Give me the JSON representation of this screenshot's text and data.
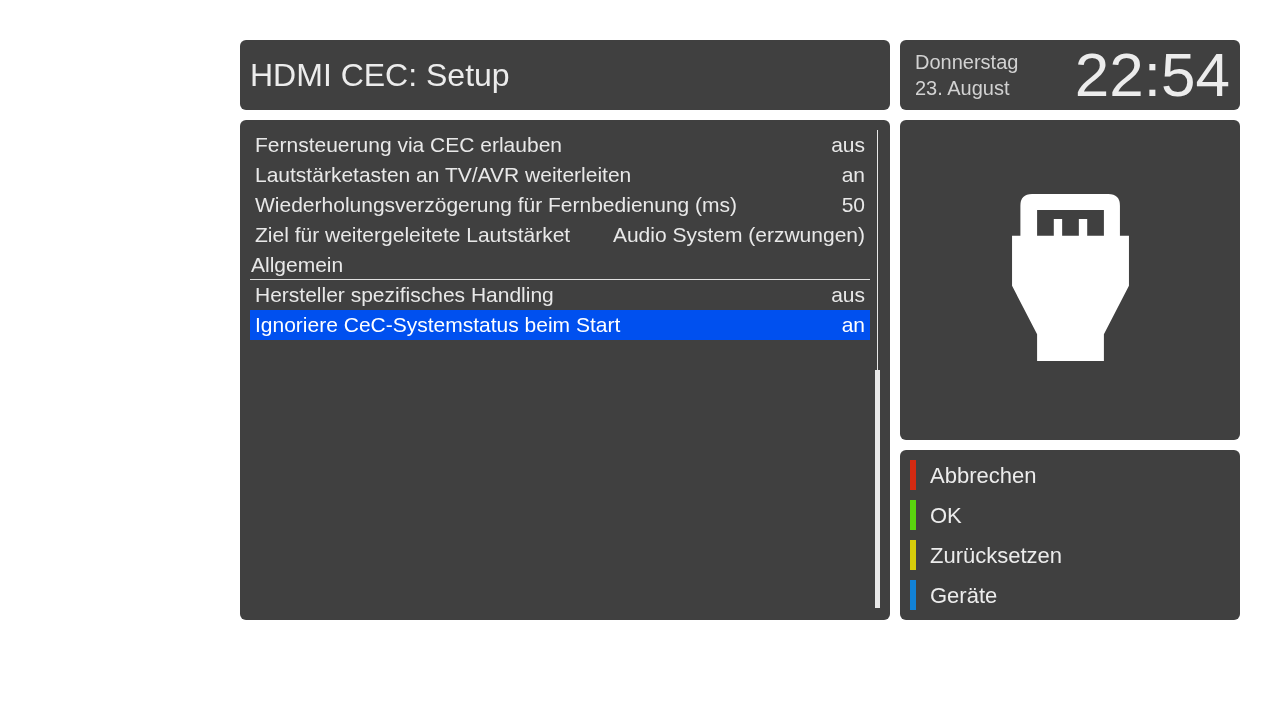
{
  "header": {
    "title": "HDMI CEC: Setup"
  },
  "clock": {
    "weekday": "Donnerstag",
    "date": "23. August",
    "time": "22:54"
  },
  "settings": [
    {
      "kind": "option",
      "label": "Fernsteuerung via CEC erlauben",
      "value": "aus",
      "selected": false
    },
    {
      "kind": "option",
      "label": "Lautstärketasten an TV/AVR weiterleiten",
      "value": "an",
      "selected": false
    },
    {
      "kind": "option",
      "label": "Wiederholungsverzögerung für Fernbedienung (ms)",
      "value": "50",
      "selected": false
    },
    {
      "kind": "option",
      "label": "Ziel für weitergeleitete Lautstärket",
      "value": "Audio System (erzwungen)",
      "selected": false
    },
    {
      "kind": "section",
      "label": "Allgemein",
      "selected": false
    },
    {
      "kind": "option",
      "label": "Hersteller spezifisches Handling",
      "value": "aus",
      "selected": false
    },
    {
      "kind": "option",
      "label": "Ignoriere CeC-Systemstatus beim Start",
      "value": "an",
      "selected": true
    }
  ],
  "color_buttons": [
    {
      "label": "Abbrechen",
      "color": "#d42a12"
    },
    {
      "label": "OK",
      "color": "#5ad40e"
    },
    {
      "label": "Zurücksetzen",
      "color": "#d6cc0a"
    },
    {
      "label": "Geräte",
      "color": "#1282d6"
    }
  ]
}
